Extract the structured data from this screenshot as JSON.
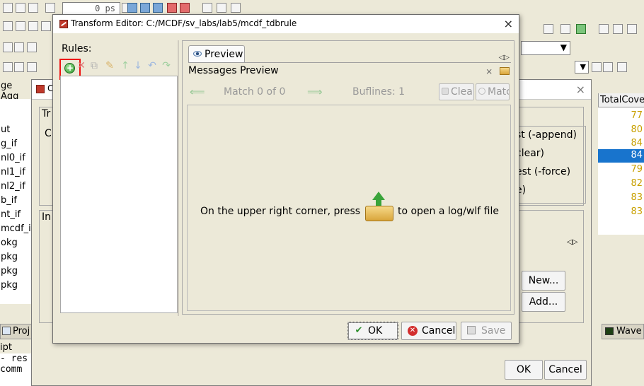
{
  "background_app": {
    "time_value": "0 ps",
    "left_header": "ge Agg",
    "left_items": [
      "ut",
      "g_if",
      "nl0_if",
      "nl1_if",
      "nl2_if",
      "b_if",
      "nt_if",
      "mcdf_if",
      "okg",
      "pkg",
      "pkg",
      "pkg"
    ],
    "total_coverage_header": "TotalCove",
    "coverage_values": [
      "77",
      "80",
      "84",
      "84",
      "79",
      "82",
      "83",
      "83"
    ],
    "project_tab": "Proj",
    "wave_tab": "Wave",
    "script_lines": [
      "ipt",
      "- res",
      " comm"
    ]
  },
  "coverage_dialog": {
    "title_fragment": "C",
    "close_glyph": "×",
    "group_labels": [
      "Tr",
      "In"
    ],
    "first_letters": [
      "C"
    ],
    "radio_options": [
      "st (-append)",
      "clear)",
      "est (-force)",
      "e)"
    ],
    "new_button": "New...",
    "add_button": "Add...",
    "ok_button": "OK",
    "cancel_button": "Cancel"
  },
  "transform_editor": {
    "title": "Transform Editor: C:/MCDF/sv_labs/lab5/mcdf_tdbrule",
    "close_glyph": "×",
    "rules_label": "Rules:",
    "preview_tab": "Preview",
    "messages_preview_title": "Messages Preview",
    "match_text": "Match 0 of 0",
    "buflines_text": "Buflines: 1",
    "clear_button": "Clear",
    "match_button": "Match",
    "hint_before": "On the upper right corner, press",
    "hint_after": "to open a log/wlf file",
    "ok_button": "OK",
    "cancel_button": "Cancel",
    "save_button": "Save"
  },
  "colors": {
    "highlight": "#e11111",
    "selection": "#1874cd",
    "coverage_number": "#c8a000"
  }
}
